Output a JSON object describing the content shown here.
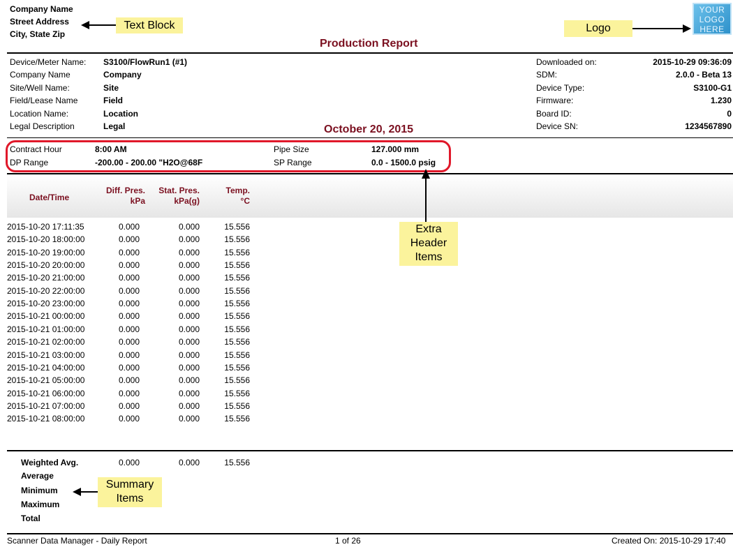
{
  "company": {
    "name": "Company Name",
    "street": "Street Address",
    "city": "City, State Zip"
  },
  "callouts": {
    "text_block": "Text Block",
    "logo": "Logo",
    "extra_header": [
      "Extra",
      "Header",
      "Items"
    ],
    "summary": [
      "Summary",
      "Items"
    ]
  },
  "logo_lines": [
    "YOUR",
    "LOGO",
    "HERE"
  ],
  "report_title": "Production Report",
  "report_date": "October 20, 2015",
  "left_info": [
    {
      "label": "Device/Meter Name:",
      "value": "S3100/FlowRun1 (#1)"
    },
    {
      "label": "Company Name",
      "value": "Company"
    },
    {
      "label": "Site/Well Name:",
      "value": "Site"
    },
    {
      "label": "Field/Lease Name",
      "value": "Field"
    },
    {
      "label": "Location Name:",
      "value": "Location"
    },
    {
      "label": "Legal Description",
      "value": "Legal"
    }
  ],
  "right_info": [
    {
      "label": "Downloaded on:",
      "value": "2015-10-29 09:36:09"
    },
    {
      "label": "SDM:",
      "value": "2.0.0 - Beta 13"
    },
    {
      "label": "Device Type:",
      "value": "S3100-G1"
    },
    {
      "label": "Firmware:",
      "value": "1.230"
    },
    {
      "label": "Board ID:",
      "value": "0"
    },
    {
      "label": "Device SN:",
      "value": "1234567890"
    }
  ],
  "extra": {
    "contract_hour_label": "Contract Hour",
    "contract_hour_value": "8:00 AM",
    "dp_range_label": "DP Range",
    "dp_range_value": "-200.00 - 200.00 \"H2O@68F",
    "pipe_size_label": "Pipe Size",
    "pipe_size_value": "127.000 mm",
    "sp_range_label": "SP Range",
    "sp_range_value": "0.0 - 1500.0 psig"
  },
  "columns": {
    "datetime": "Date/Time",
    "diff_pres": [
      "Diff. Pres.",
      "kPa"
    ],
    "stat_pres": [
      "Stat. Pres.",
      "kPa(g)"
    ],
    "temp": [
      "Temp.",
      "°C"
    ]
  },
  "rows": [
    {
      "dt": "2015-10-20 17:11:35",
      "dp": "0.000",
      "sp": "0.000",
      "t": "15.556"
    },
    {
      "dt": "2015-10-20 18:00:00",
      "dp": "0.000",
      "sp": "0.000",
      "t": "15.556"
    },
    {
      "dt": "2015-10-20 19:00:00",
      "dp": "0.000",
      "sp": "0.000",
      "t": "15.556"
    },
    {
      "dt": "2015-10-20 20:00:00",
      "dp": "0.000",
      "sp": "0.000",
      "t": "15.556"
    },
    {
      "dt": "2015-10-20 21:00:00",
      "dp": "0.000",
      "sp": "0.000",
      "t": "15.556"
    },
    {
      "dt": "2015-10-20 22:00:00",
      "dp": "0.000",
      "sp": "0.000",
      "t": "15.556"
    },
    {
      "dt": "2015-10-20 23:00:00",
      "dp": "0.000",
      "sp": "0.000",
      "t": "15.556"
    },
    {
      "dt": "2015-10-21 00:00:00",
      "dp": "0.000",
      "sp": "0.000",
      "t": "15.556"
    },
    {
      "dt": "2015-10-21 01:00:00",
      "dp": "0.000",
      "sp": "0.000",
      "t": "15.556"
    },
    {
      "dt": "2015-10-21 02:00:00",
      "dp": "0.000",
      "sp": "0.000",
      "t": "15.556"
    },
    {
      "dt": "2015-10-21 03:00:00",
      "dp": "0.000",
      "sp": "0.000",
      "t": "15.556"
    },
    {
      "dt": "2015-10-21 04:00:00",
      "dp": "0.000",
      "sp": "0.000",
      "t": "15.556"
    },
    {
      "dt": "2015-10-21 05:00:00",
      "dp": "0.000",
      "sp": "0.000",
      "t": "15.556"
    },
    {
      "dt": "2015-10-21 06:00:00",
      "dp": "0.000",
      "sp": "0.000",
      "t": "15.556"
    },
    {
      "dt": "2015-10-21 07:00:00",
      "dp": "0.000",
      "sp": "0.000",
      "t": "15.556"
    },
    {
      "dt": "2015-10-21 08:00:00",
      "dp": "0.000",
      "sp": "0.000",
      "t": "15.556"
    }
  ],
  "summary": {
    "weighted_avg_label": "Weighted Avg.",
    "weighted_avg": {
      "dp": "0.000",
      "sp": "0.000",
      "t": "15.556"
    },
    "average_label": "Average",
    "minimum_label": "Minimum",
    "maximum_label": "Maximum",
    "total_label": "Total"
  },
  "footer": {
    "left": "Scanner Data Manager - Daily Report",
    "center": "1 of 26",
    "right": "Created On: 2015-10-29 17:40"
  },
  "colors": {
    "accent": "#7b1020",
    "callout": "#fbf39c",
    "highlight_ring": "#e0182a"
  }
}
